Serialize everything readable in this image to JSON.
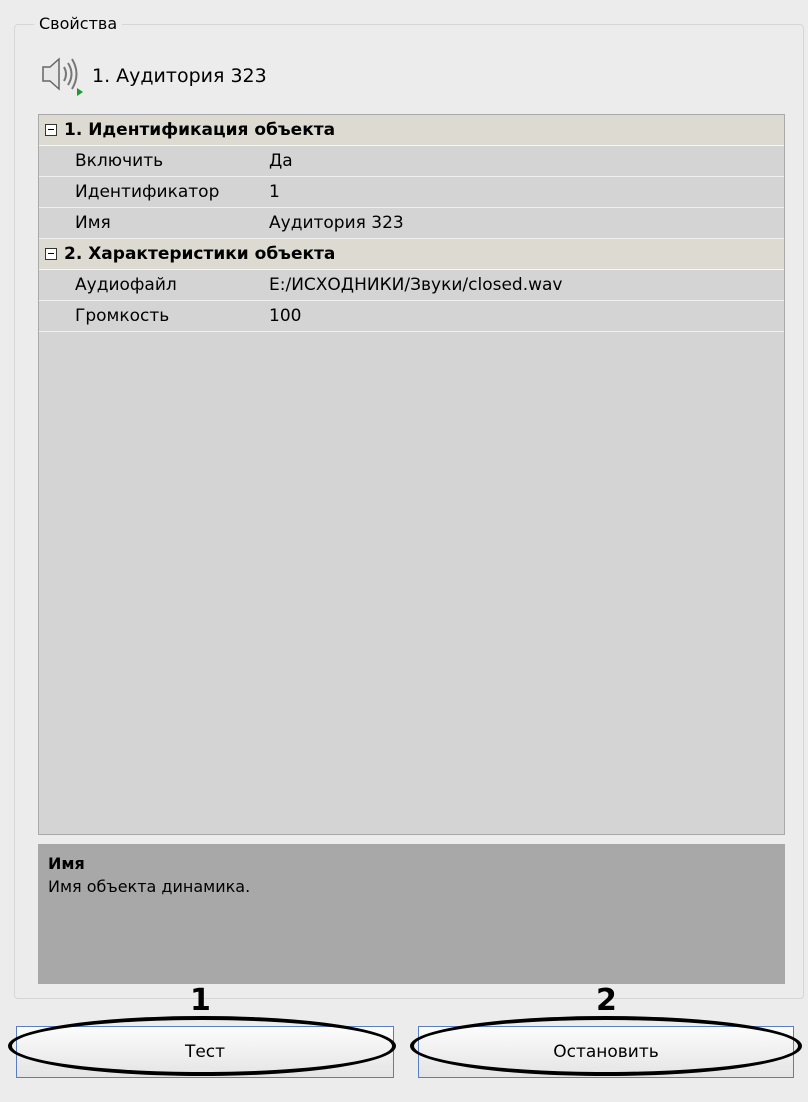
{
  "panel": {
    "title": "Свойства"
  },
  "object": {
    "icon": "speaker-icon",
    "title": "1. Аудитория 323"
  },
  "categories": [
    {
      "label": "1. Идентификация объекта",
      "properties": [
        {
          "name": "Включить",
          "value": "Да"
        },
        {
          "name": "Идентификатор",
          "value": "1"
        },
        {
          "name": "Имя",
          "value": "Аудитория 323"
        }
      ]
    },
    {
      "label": "2. Характеристики объекта",
      "properties": [
        {
          "name": "Аудиофайл",
          "value": "E:/ИСХОДНИКИ/Звуки/closed.wav"
        },
        {
          "name": "Громкость",
          "value": "100"
        }
      ]
    }
  ],
  "description": {
    "title": "Имя",
    "text": "Имя объекта динамика."
  },
  "buttons": {
    "test": "Тест",
    "stop": "Остановить"
  },
  "annotations": {
    "test": "1",
    "stop": "2"
  }
}
